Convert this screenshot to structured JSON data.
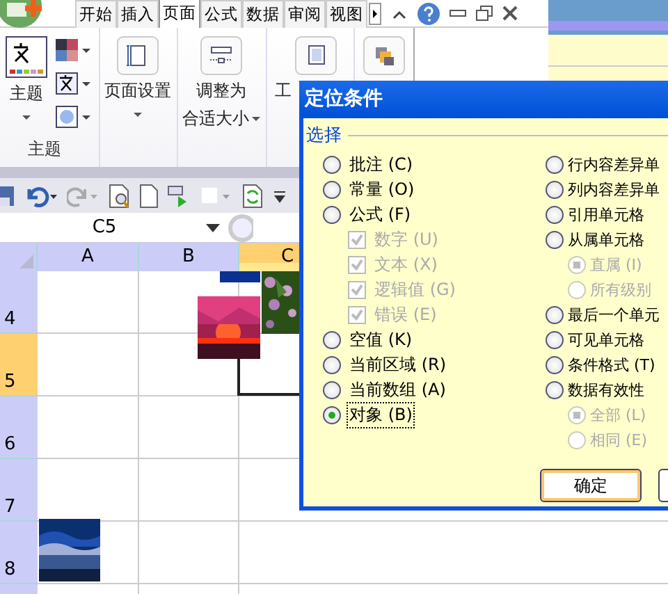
{
  "ribbon_tabs": [
    {
      "label": "开始",
      "selected": false
    },
    {
      "label": "插入",
      "selected": false
    },
    {
      "label": "页面",
      "selected": true
    },
    {
      "label": "公式",
      "selected": false
    },
    {
      "label": "数据",
      "selected": false
    },
    {
      "label": "审阅",
      "selected": false
    },
    {
      "label": "视图",
      "selected": false
    }
  ],
  "ribbon": {
    "theme_button": "主题",
    "theme_group_label": "主题",
    "page_setup_button": "页面设置",
    "scale_button": [
      "调整为",
      "合适大小"
    ],
    "sheet_options_button": "工"
  },
  "name_box": "C5",
  "columns": [
    {
      "label": "A",
      "selected": false
    },
    {
      "label": "B",
      "selected": false
    },
    {
      "label": "C",
      "selected": true
    }
  ],
  "rows": [
    {
      "label": "4",
      "selected": false
    },
    {
      "label": "5",
      "selected": true
    },
    {
      "label": "6",
      "selected": false
    },
    {
      "label": "7",
      "selected": false
    },
    {
      "label": "8",
      "selected": false
    }
  ],
  "dialog": {
    "title": "定位条件",
    "group_label": "选择",
    "left_options": [
      {
        "kind": "radio",
        "label": "批注 (C)",
        "selected": false,
        "disabled": false
      },
      {
        "kind": "radio",
        "label": "常量 (O)",
        "selected": false,
        "disabled": false
      },
      {
        "kind": "radio",
        "label": "公式 (F)",
        "selected": false,
        "disabled": false,
        "children": [
          {
            "kind": "checkbox",
            "label": "数字 (U)",
            "checked": true,
            "disabled": true
          },
          {
            "kind": "checkbox",
            "label": "文本 (X)",
            "checked": true,
            "disabled": true
          },
          {
            "kind": "checkbox",
            "label": "逻辑值 (G)",
            "checked": true,
            "disabled": true
          },
          {
            "kind": "checkbox",
            "label": "错误 (E)",
            "checked": true,
            "disabled": true
          }
        ]
      },
      {
        "kind": "radio",
        "label": "空值 (K)",
        "selected": false,
        "disabled": false
      },
      {
        "kind": "radio",
        "label": "当前区域 (R)",
        "selected": false,
        "disabled": false
      },
      {
        "kind": "radio",
        "label": "当前数组 (A)",
        "selected": false,
        "disabled": false
      },
      {
        "kind": "radio",
        "label": "对象 (B)",
        "selected": true,
        "disabled": false
      }
    ],
    "right_options": [
      {
        "kind": "radio",
        "label": "行内容差异单",
        "selected": false,
        "disabled": false
      },
      {
        "kind": "radio",
        "label": "列内容差异单",
        "selected": false,
        "disabled": false
      },
      {
        "kind": "radio",
        "label": "引用单元格",
        "selected": false,
        "disabled": false
      },
      {
        "kind": "radio",
        "label": "从属单元格",
        "selected": false,
        "disabled": false,
        "children": [
          {
            "kind": "radio",
            "label": "直属 (I)",
            "selected": true,
            "disabled": true
          },
          {
            "kind": "radio",
            "label": "所有级别",
            "selected": false,
            "disabled": true
          }
        ]
      },
      {
        "kind": "radio",
        "label": "最后一个单元",
        "selected": false,
        "disabled": false
      },
      {
        "kind": "radio",
        "label": "可见单元格",
        "selected": false,
        "disabled": false
      },
      {
        "kind": "radio",
        "label": "条件格式 (T)",
        "selected": false,
        "disabled": false
      },
      {
        "kind": "radio",
        "label": "数据有效性",
        "selected": false,
        "disabled": false,
        "children": [
          {
            "kind": "radio",
            "label": "全部 (L)",
            "selected": true,
            "disabled": true
          },
          {
            "kind": "radio",
            "label": "相同 (E)",
            "selected": false,
            "disabled": true
          }
        ]
      }
    ],
    "buttons": [
      "确定"
    ]
  }
}
